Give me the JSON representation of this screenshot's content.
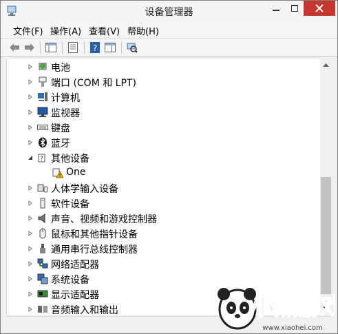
{
  "window": {
    "title": "设备管理器"
  },
  "menu": [
    "文件(F)",
    "操作(A)",
    "查看(V)",
    "帮助(H)"
  ],
  "toolbar": [
    "back",
    "forward",
    "show-hide-tree",
    "properties",
    "help",
    "action-pane",
    "scan-hardware"
  ],
  "tree": [
    {
      "label": "电池",
      "expanded": false,
      "indent": 0,
      "icon": "battery-icon"
    },
    {
      "label": "端口 (COM 和 LPT)",
      "expanded": false,
      "indent": 0,
      "icon": "port-icon"
    },
    {
      "label": "计算机",
      "expanded": false,
      "indent": 0,
      "icon": "computer-icon"
    },
    {
      "label": "监视器",
      "expanded": false,
      "indent": 0,
      "icon": "monitor-icon"
    },
    {
      "label": "键盘",
      "expanded": false,
      "indent": 0,
      "icon": "keyboard-icon"
    },
    {
      "label": "蓝牙",
      "expanded": false,
      "indent": 0,
      "icon": "bluetooth-icon"
    },
    {
      "label": "其他设备",
      "expanded": true,
      "indent": 0,
      "icon": "unknown-device-icon"
    },
    {
      "label": "One",
      "expanded": null,
      "indent": 1,
      "icon": "warning-device-icon"
    },
    {
      "label": "人体学输入设备",
      "expanded": false,
      "indent": 0,
      "icon": "hid-icon"
    },
    {
      "label": "软件设备",
      "expanded": false,
      "indent": 0,
      "icon": "software-device-icon"
    },
    {
      "label": "声音、视频和游戏控制器",
      "expanded": false,
      "indent": 0,
      "icon": "speaker-icon"
    },
    {
      "label": "鼠标和其他指针设备",
      "expanded": false,
      "indent": 0,
      "icon": "mouse-icon"
    },
    {
      "label": "通用串行总线控制器",
      "expanded": false,
      "indent": 0,
      "icon": "usb-icon"
    },
    {
      "label": "网络适配器",
      "expanded": false,
      "indent": 0,
      "icon": "network-icon"
    },
    {
      "label": "系统设备",
      "expanded": false,
      "indent": 0,
      "icon": "system-device-icon"
    },
    {
      "label": "显示适配器",
      "expanded": false,
      "indent": 0,
      "icon": "display-adapter-icon"
    },
    {
      "label": "音频输入和输出",
      "expanded": false,
      "indent": 0,
      "icon": "audio-io-icon"
    }
  ],
  "watermark": {
    "brand": "小黑游戏",
    "url": "www.xiaohei.com"
  },
  "colors": {
    "close": "#c7372f",
    "scroll_thumb": "#c2c2c2"
  }
}
